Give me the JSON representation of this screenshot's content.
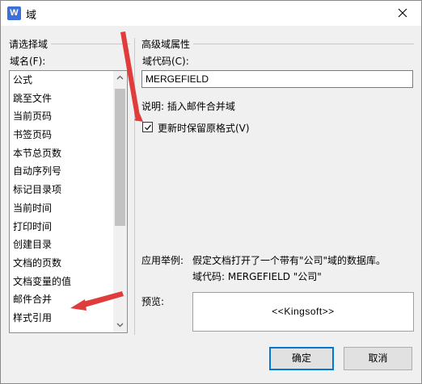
{
  "window": {
    "title": "域",
    "app_icon_letter": "W"
  },
  "left_panel": {
    "group_title": "请选择域",
    "list_label": "域名(F):",
    "items": [
      "公式",
      "跳至文件",
      "当前页码",
      "书签页码",
      "本节总页数",
      "自动序列号",
      "标记目录项",
      "当前时间",
      "打印时间",
      "创建目录",
      "文档的页数",
      "文档变量的值",
      "邮件合并",
      "样式引用"
    ],
    "selected_item": "邮件合并"
  },
  "right_panel": {
    "group_title": "高级域属性",
    "code_label": "域代码(C):",
    "code_value": "MERGEFIELD",
    "description": "说明: 插入邮件合并域",
    "checkbox_label": "更新时保留原格式(V)",
    "checkbox_checked": true,
    "example_label": "应用举例:",
    "example_line1": "假定文档打开了一个带有\"公司\"域的数据库。",
    "example_line2": "域代码:  MERGEFIELD \"公司\"",
    "preview_label": "预览:",
    "preview_value": "<<Kingsoft>>"
  },
  "buttons": {
    "ok": "确定",
    "cancel": "取消"
  },
  "colors": {
    "annotation_arrow": "#e03c3c",
    "app_icon": "#3d6fd9",
    "default_button_border": "#0078d7"
  }
}
